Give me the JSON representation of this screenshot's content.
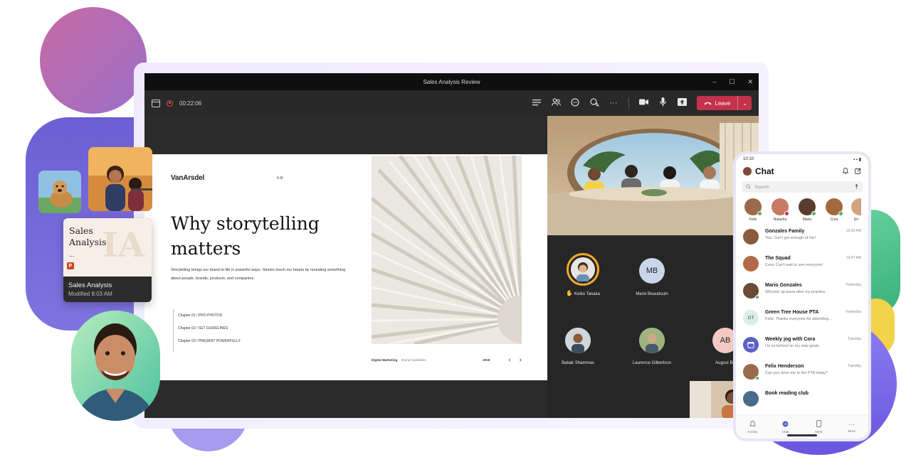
{
  "window": {
    "title": "Sales Analysis Review",
    "minimize": "–",
    "maximize": "☐",
    "close": "✕"
  },
  "toolbar": {
    "timer": "00:22:06",
    "leave_label": "Leave",
    "leave_caret": "⌄",
    "more": "···",
    "icons": [
      "calendar-icon",
      "record-icon",
      "chat-list-icon",
      "people-icon",
      "chat-bubble-icon",
      "reactions-icon",
      "more-icon",
      "camera-icon",
      "mic-icon",
      "share-icon",
      "phone-hangup-icon"
    ]
  },
  "slide": {
    "brand": "VanArsdel",
    "number": "II-III",
    "heading": "Why storytelling matters",
    "body": "Storytelling brings our brand to life in powerful ways. Stories touch our hearts by revealing something about people, brands, products, and companies.",
    "chapters": [
      "Chapter 01 / PRO PHOTOS",
      "Chapter 02 / SET GUIDELINES",
      "Chapter 03 / PRESENT POWERFULLY"
    ],
    "footer_left": "Digital Marketing",
    "footer_mid": "Brand Guidelines",
    "footer_year": "2019",
    "prev": "‹",
    "next": "›"
  },
  "participants": [
    {
      "name": "Keiko Tanaka",
      "initials": "",
      "raised_hand": true,
      "speaking": true
    },
    {
      "name": "Mario Beaudouin",
      "initials": "MB",
      "raised_hand": false,
      "speaking": false
    },
    {
      "name": "Babak Shammas",
      "initials": "",
      "raised_hand": false,
      "speaking": false
    },
    {
      "name": "Laurence Gilbertson",
      "initials": "",
      "raised_hand": false,
      "speaking": false
    },
    {
      "name": "August Be",
      "initials": "AB",
      "raised_hand": false,
      "speaking": false
    }
  ],
  "file_card": {
    "thumb_title": "Sales Analysis",
    "thumb_sub": "...",
    "name": "Sales Analysis",
    "modified": "Modified 8:03 AM"
  },
  "phone": {
    "time": "10:10",
    "signal": "▪ ▪ ▮",
    "title": "Chat",
    "search_placeholder": "Search",
    "stories": [
      "Felix",
      "Natasha",
      "Mario",
      "Cora",
      "Eri"
    ],
    "chats": [
      {
        "name": "Gonzales Family",
        "msg": "You: Can't get enough of her!",
        "time": "10:09 AM",
        "initials": ""
      },
      {
        "name": "The Squad",
        "msg": "Cora: Can't wait to see everyone!",
        "time": "10:47 AM",
        "initials": ""
      },
      {
        "name": "Mario Gonzales",
        "msg": "Will pick up pizza after my practice.",
        "time": "Yesterday",
        "initials": ""
      },
      {
        "name": "Green Tree House PTA",
        "msg": "Felix: Thanks everyone for attending...",
        "time": "Yesterday",
        "initials": "GT"
      },
      {
        "name": "Weekly jog with Cora",
        "msg": "I'm so behind on my step goals",
        "time": "Tuesday",
        "initials": ""
      },
      {
        "name": "Felix Henderson",
        "msg": "Can you drive me to the PTA today?",
        "time": "Tuesday",
        "initials": ""
      },
      {
        "name": "Book reading club",
        "msg": "",
        "time": "",
        "initials": ""
      }
    ],
    "nav": [
      "Activity",
      "Chat",
      "Meet",
      "More"
    ]
  },
  "colors": {
    "leave_red": "#c4314b",
    "teams_purple": "#5b5fc7",
    "speaking_ring": "#f0a92a",
    "window_dark": "#1f1f1f"
  }
}
